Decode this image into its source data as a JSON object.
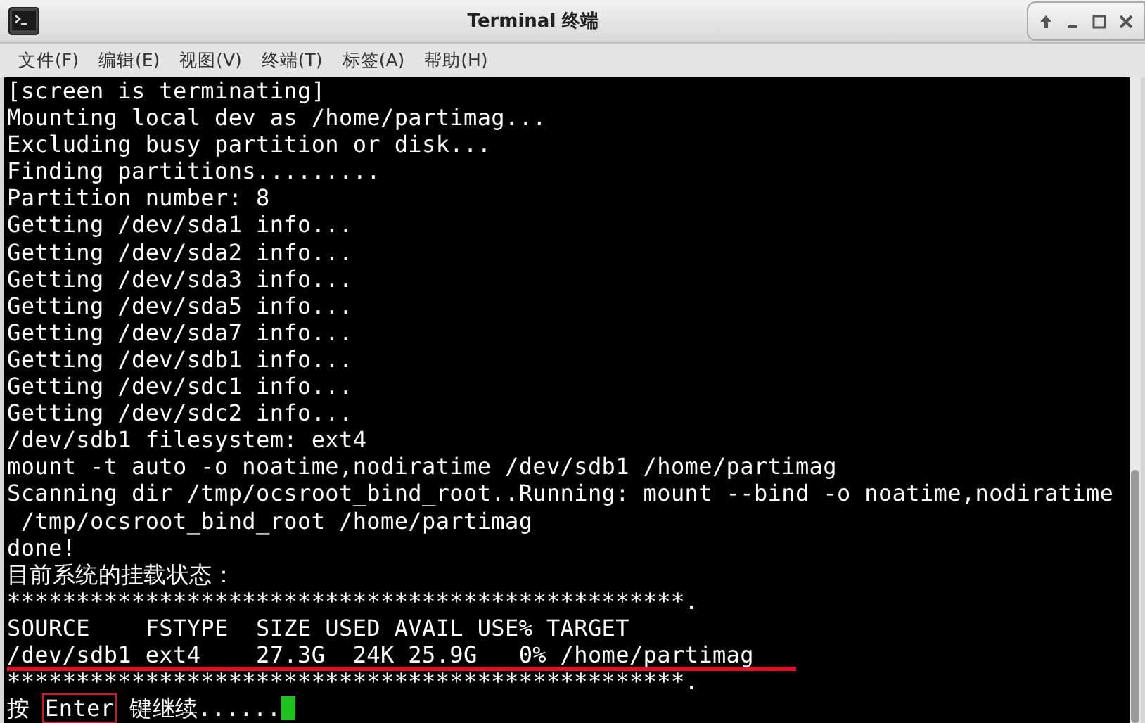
{
  "window": {
    "title": "Terminal 终端"
  },
  "menu": [
    "文件(F)",
    "编辑(E)",
    "视图(V)",
    "终端(T)",
    "标签(A)",
    "帮助(H)"
  ],
  "terminal": {
    "lines": [
      {
        "text": "[screen is terminating]",
        "underlined": false
      },
      {
        "text": "Mounting local dev as /home/partimag...",
        "underlined": false
      },
      {
        "text": "Excluding busy partition or disk...",
        "underlined": false
      },
      {
        "text": "Finding partitions.........",
        "underlined": false
      },
      {
        "text": "Partition number: 8",
        "underlined": false
      },
      {
        "text": "Getting /dev/sda1 info...",
        "underlined": false
      },
      {
        "text": "Getting /dev/sda2 info...",
        "underlined": false
      },
      {
        "text": "Getting /dev/sda3 info...",
        "underlined": false
      },
      {
        "text": "Getting /dev/sda5 info...",
        "underlined": false
      },
      {
        "text": "Getting /dev/sda7 info...",
        "underlined": false
      },
      {
        "text": "Getting /dev/sdb1 info...",
        "underlined": false
      },
      {
        "text": "Getting /dev/sdc1 info...",
        "underlined": false
      },
      {
        "text": "Getting /dev/sdc2 info...",
        "underlined": false
      },
      {
        "text": "/dev/sdb1 filesystem: ext4",
        "underlined": false
      },
      {
        "text": "mount -t auto -o noatime,nodiratime /dev/sdb1 /home/partimag",
        "underlined": false
      },
      {
        "text": "Scanning dir /tmp/ocsroot_bind_root..Running: mount --bind -o noatime,nodiratime",
        "underlined": false
      },
      {
        "text": " /tmp/ocsroot_bind_root /home/partimag",
        "underlined": false
      },
      {
        "text": "done!",
        "underlined": false
      },
      {
        "text": "目前系统的挂载状态：",
        "underlined": false
      },
      {
        "text": "*************************************************.",
        "underlined": false
      },
      {
        "text": "SOURCE    FSTYPE  SIZE USED AVAIL USE% TARGET",
        "underlined": false
      },
      {
        "text": "/dev/sdb1 ext4    27.3G  24K 25.9G   0% /home/partimag",
        "underlined": true
      },
      {
        "text": "*************************************************.",
        "underlined": false
      }
    ],
    "prompt": {
      "before": "按 ",
      "key": "Enter",
      "key_boxed": true,
      "after": " 键继续......"
    }
  }
}
